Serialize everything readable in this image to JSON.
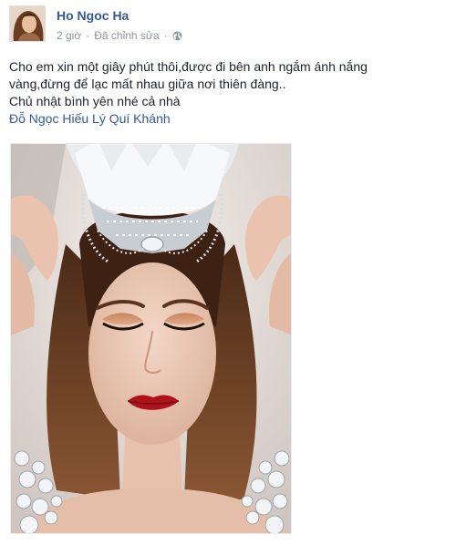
{
  "post": {
    "author": "Ho Ngoc Ha",
    "time": "2 giờ",
    "separator": "·",
    "edited": "Đã chỉnh sửa",
    "privacy_icon": "globe-icon",
    "lines": [
      "Cho em xin một giây phút thôi,được đi bên anh ngắm ánh nắng",
      "vàng,đừng để lạc mất nhau giữa nơi thiên đàng..",
      "Chủ nhật bình yên nhé cả nhà"
    ],
    "tagged": "Đỗ Ngọc Hiếu Lý Quí Khánh"
  },
  "colors": {
    "link": "#365899",
    "meta": "#90949c",
    "text": "#1d2129",
    "lips": "#b0121b"
  }
}
